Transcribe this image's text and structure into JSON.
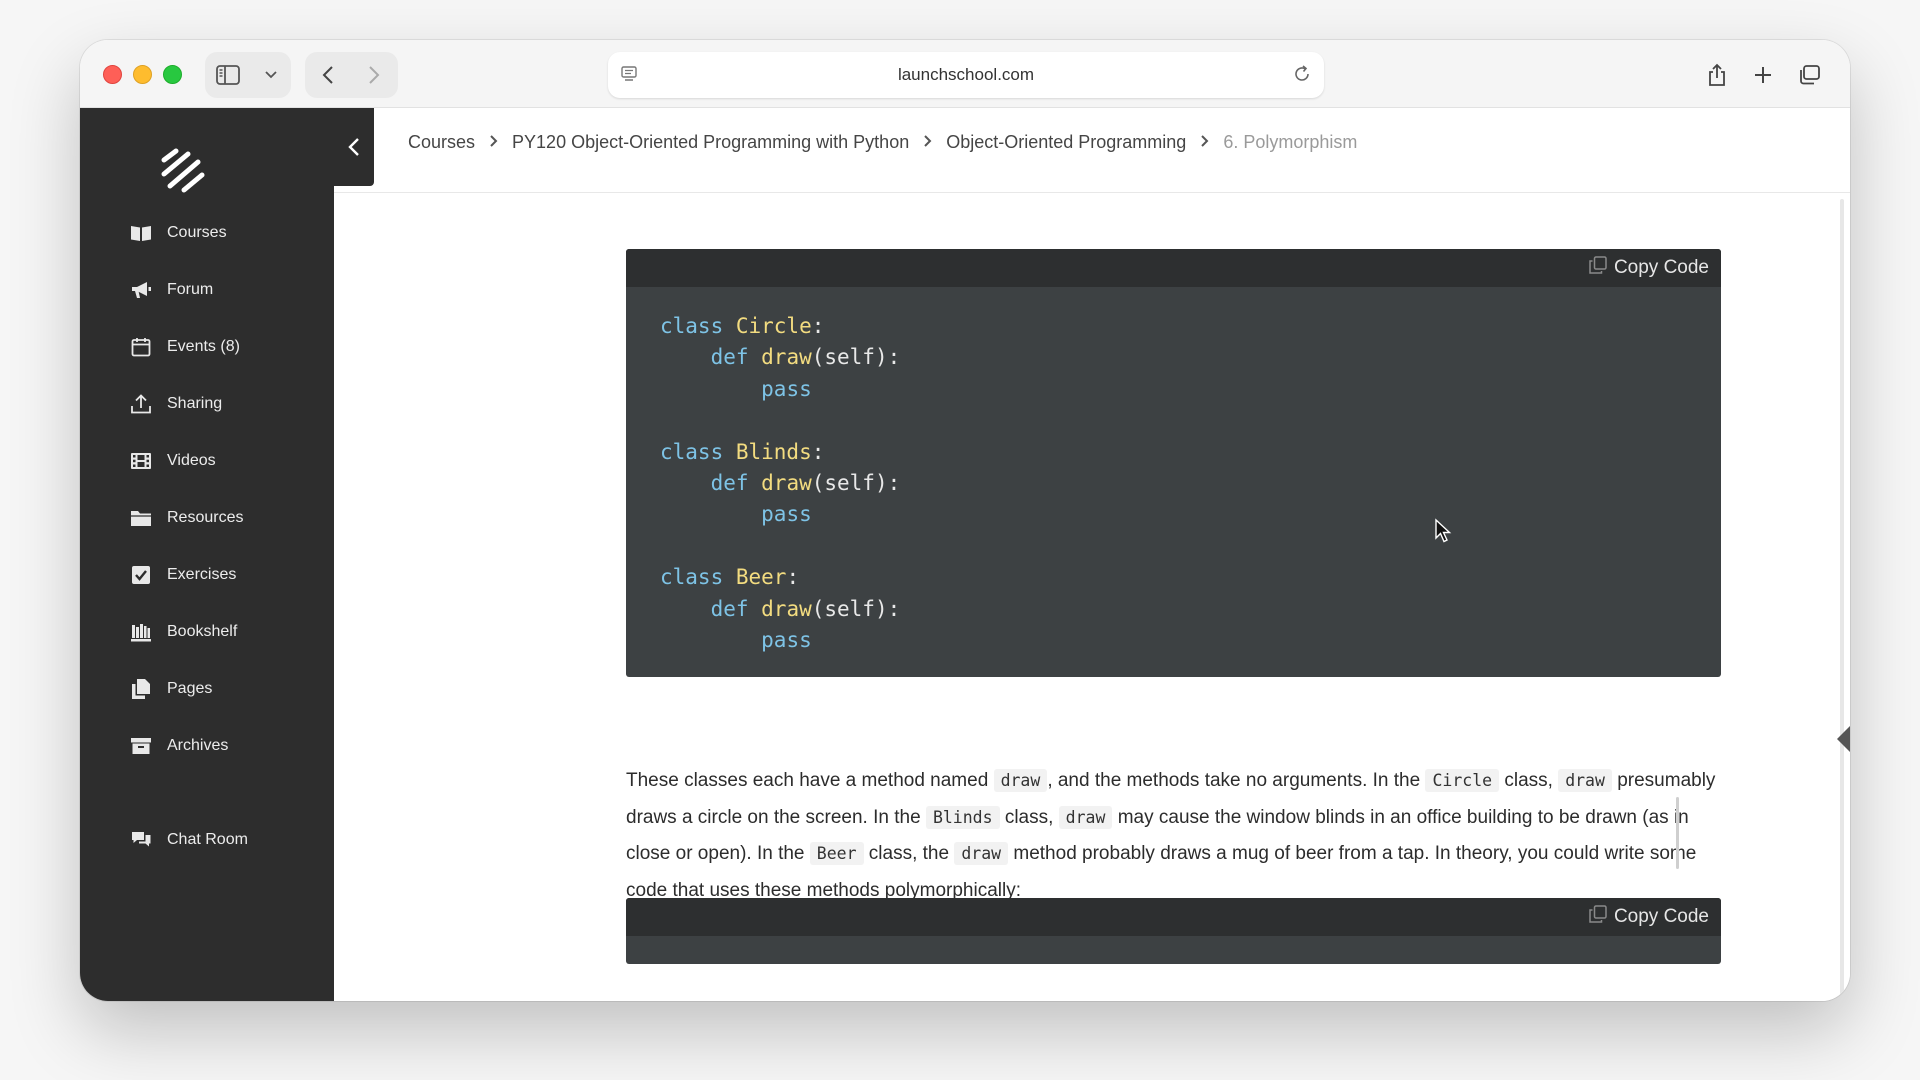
{
  "browser": {
    "url": "launchschool.com"
  },
  "sidebar": {
    "items": [
      {
        "label": "Courses",
        "icon": "book-icon"
      },
      {
        "label": "Forum",
        "icon": "megaphone-icon"
      },
      {
        "label": "Events (8)",
        "icon": "calendar-icon"
      },
      {
        "label": "Sharing",
        "icon": "share-upload-icon"
      },
      {
        "label": "Videos",
        "icon": "film-icon"
      },
      {
        "label": "Resources",
        "icon": "folder-icon"
      },
      {
        "label": "Exercises",
        "icon": "checkbox-icon"
      },
      {
        "label": "Bookshelf",
        "icon": "bookshelf-icon"
      },
      {
        "label": "Pages",
        "icon": "pages-icon"
      },
      {
        "label": "Archives",
        "icon": "archive-icon"
      }
    ],
    "chat_room": {
      "label": "Chat Room",
      "icon": "chat-icon"
    }
  },
  "breadcrumb": {
    "items": [
      "Courses",
      "PY120 Object-Oriented Programming with Python",
      "Object-Oriented Programming"
    ],
    "current": "6. Polymorphism"
  },
  "code_block_1": {
    "copy_label": "Copy Code",
    "lines": [
      [
        [
          "kw",
          "class "
        ],
        [
          "cls",
          "Circle"
        ],
        [
          "pn",
          ":"
        ]
      ],
      [
        [
          "pn",
          "    "
        ],
        [
          "kw",
          "def "
        ],
        [
          "fn",
          "draw"
        ],
        [
          "pn",
          "(self):"
        ]
      ],
      [
        [
          "pn",
          "        "
        ],
        [
          "kw",
          "pass"
        ]
      ],
      [
        [
          "pn",
          ""
        ]
      ],
      [
        [
          "kw",
          "class "
        ],
        [
          "cls",
          "Blinds"
        ],
        [
          "pn",
          ":"
        ]
      ],
      [
        [
          "pn",
          "    "
        ],
        [
          "kw",
          "def "
        ],
        [
          "fn",
          "draw"
        ],
        [
          "pn",
          "(self):"
        ]
      ],
      [
        [
          "pn",
          "        "
        ],
        [
          "kw",
          "pass"
        ]
      ],
      [
        [
          "pn",
          ""
        ]
      ],
      [
        [
          "kw",
          "class "
        ],
        [
          "cls",
          "Beer"
        ],
        [
          "pn",
          ":"
        ]
      ],
      [
        [
          "pn",
          "    "
        ],
        [
          "kw",
          "def "
        ],
        [
          "fn",
          "draw"
        ],
        [
          "pn",
          "(self):"
        ]
      ],
      [
        [
          "pn",
          "        "
        ],
        [
          "kw",
          "pass"
        ]
      ]
    ]
  },
  "paragraph": {
    "segments": [
      [
        "t",
        "These classes each have a method named "
      ],
      [
        "c",
        "draw"
      ],
      [
        "t",
        ", and the methods take no arguments. In the "
      ],
      [
        "c",
        "Circle"
      ],
      [
        "t",
        " class, "
      ],
      [
        "c",
        "draw"
      ],
      [
        "t",
        " presumably draws a circle on the screen. In the "
      ],
      [
        "c",
        "Blinds"
      ],
      [
        "t",
        " class, "
      ],
      [
        "c",
        "draw"
      ],
      [
        "t",
        " may cause the window blinds in an office building to be drawn (as in close or open). In the "
      ],
      [
        "c",
        "Beer"
      ],
      [
        "t",
        " class, the "
      ],
      [
        "c",
        "draw"
      ],
      [
        "t",
        " method probably draws a mug of beer from a tap. In theory, you could write some code that uses these methods polymorphically:"
      ]
    ]
  },
  "code_block_2": {
    "copy_label": "Copy Code"
  }
}
